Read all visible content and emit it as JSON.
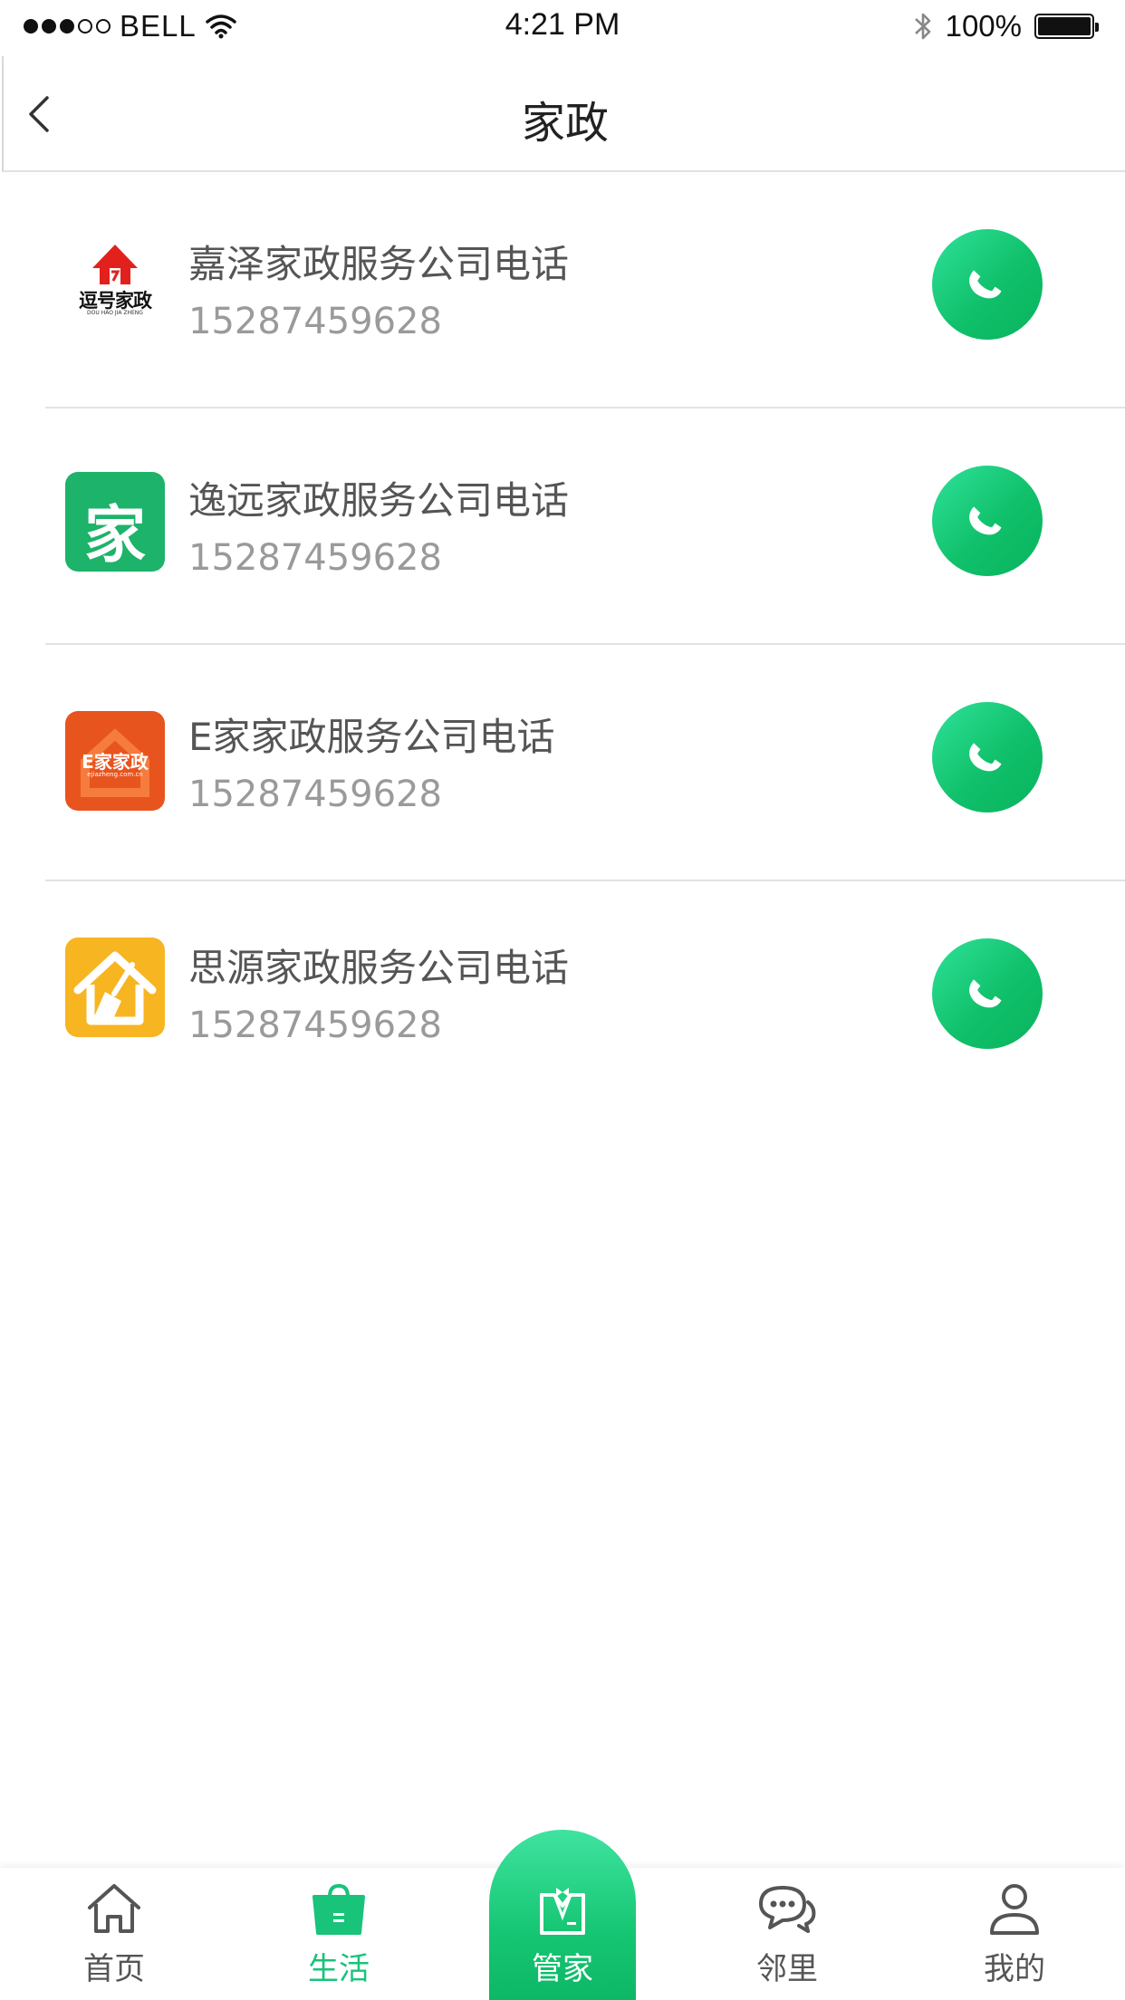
{
  "status_bar": {
    "carrier": "BELL",
    "time": "4:21 PM",
    "battery": "100%"
  },
  "nav": {
    "title": "家政"
  },
  "providers": [
    {
      "name": "嘉泽家政服务公司电话",
      "phone": "15287459628",
      "logo_text": "逗号家政",
      "logo_subtext": "DOU HAO JIA ZHENG"
    },
    {
      "name": "逸远家政服务公司电话",
      "phone": "15287459628",
      "logo_text": "家"
    },
    {
      "name": "E家家政服务公司电话",
      "phone": "15287459628",
      "logo_text": "E家家政",
      "logo_subtext": "ejiazheng.com.cn"
    },
    {
      "name": "思源家政服务公司电话",
      "phone": "15287459628"
    }
  ],
  "tab_bar": {
    "tabs": [
      {
        "label": "首页",
        "icon": "home-icon"
      },
      {
        "label": "生活",
        "icon": "shopping-bag-icon"
      },
      {
        "label": "管家",
        "icon": "butler-icon"
      },
      {
        "label": "邻里",
        "icon": "chat-icon"
      },
      {
        "label": "我的",
        "icon": "user-icon"
      }
    ]
  },
  "colors": {
    "accent": "#19c37a",
    "call_button": "#10c06a",
    "logo2_bg": "#1db36a",
    "logo3_bg": "#e8541e",
    "logo4_bg": "#f7b522"
  }
}
